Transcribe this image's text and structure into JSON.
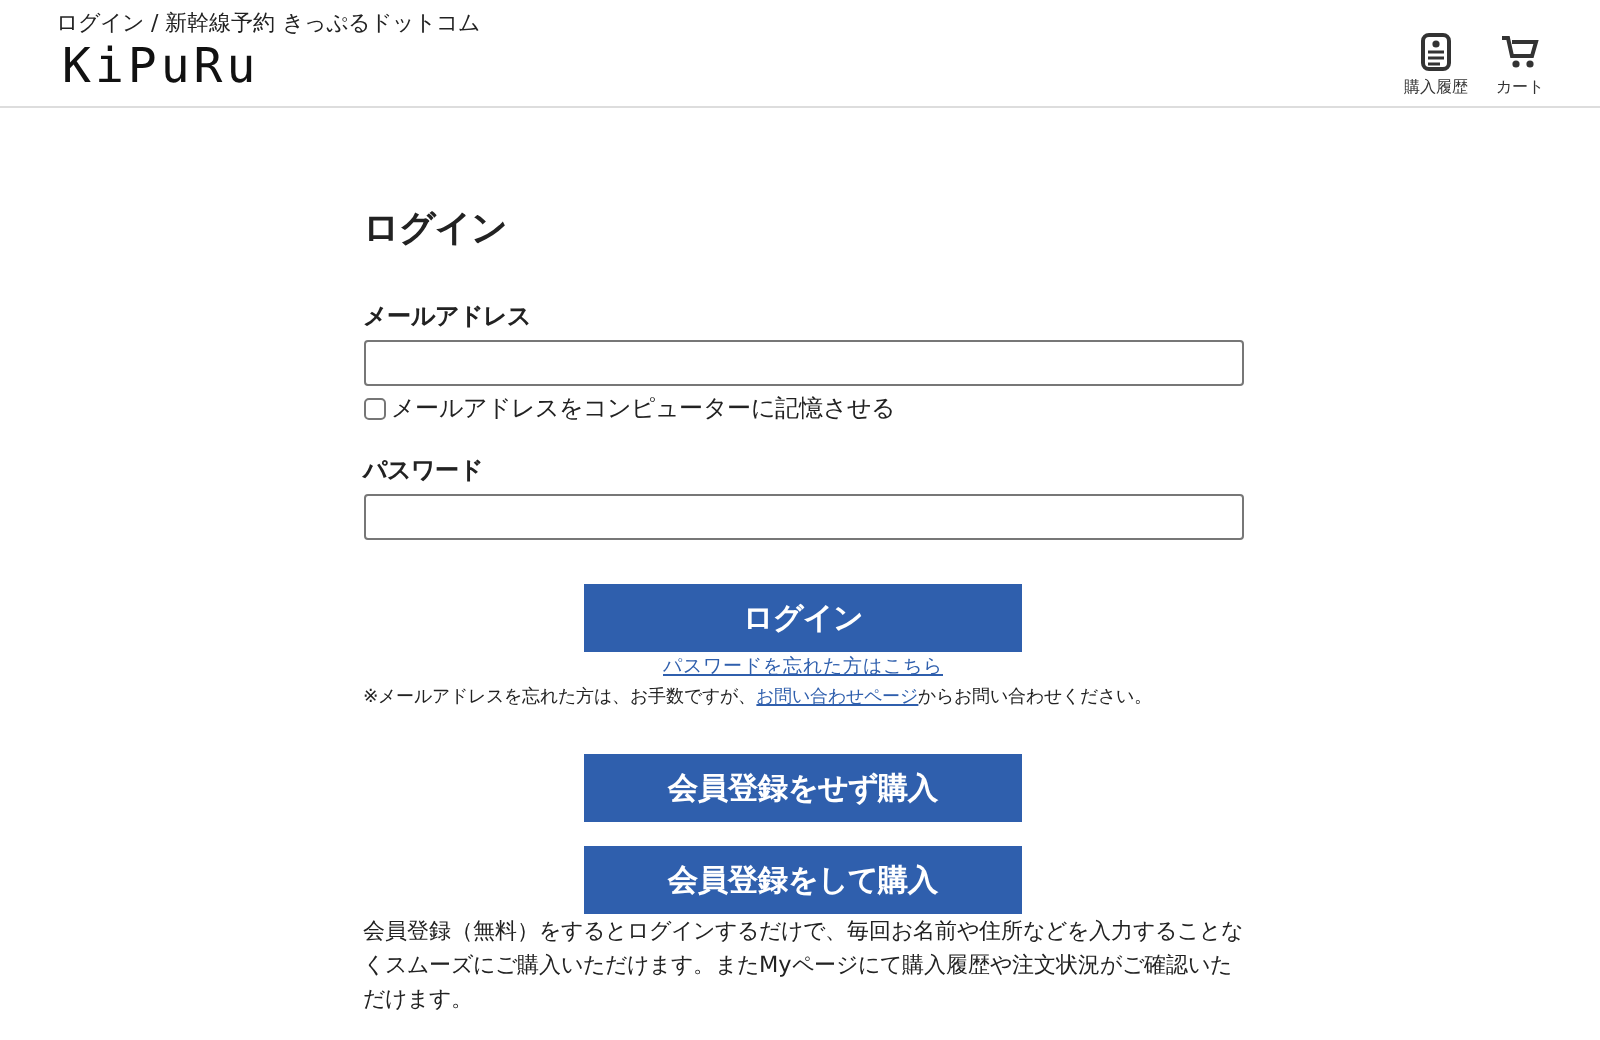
{
  "breadcrumb": "ログイン / 新幹線予約 きっぷるドットコム",
  "logo": "KiPuRu",
  "header_links": [
    {
      "kind": "history",
      "label": "購入履歴"
    },
    {
      "kind": "cart",
      "label": "カート"
    }
  ],
  "heading": "ログイン",
  "email": {
    "label": "メールアドレス"
  },
  "remember": {
    "label": "メールアドレスをコンピューターに記憶させる",
    "checked": false
  },
  "password": {
    "label": "パスワード"
  },
  "login_button": "ログイン",
  "forgot_link": "パスワードを忘れた方はこちら",
  "note": {
    "before": "※メールアドレスを忘れた方は、お手数ですが、",
    "link": "お問い合わせページ",
    "after": "からお問い合わせください。"
  },
  "guest_button": "会員登録をせず購入",
  "register_button": "会員登録をして購入",
  "info": "会員登録（無料）をするとログインするだけで、毎回お名前や住所などを入力することなくスムーズにご購入いただけます。またMyページにて購入履歴や注文状況がご確認いただけます。"
}
